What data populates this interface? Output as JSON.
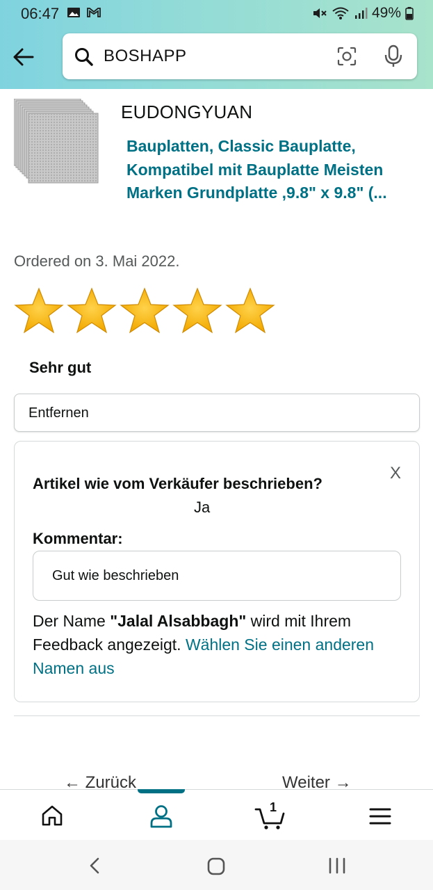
{
  "status_bar": {
    "time": "06:47",
    "battery": "49%"
  },
  "search": {
    "query": "BOSHAPP"
  },
  "product": {
    "brand": "EUDONGYUAN",
    "title": "Bauplatten, Classic Bauplatte, Kompatibel mit Bauplatte Meisten Marken Grundplatte ,9.8\" x 9.8\" (...",
    "ordered": "Ordered on 3. Mai 2022."
  },
  "rating": {
    "stars": 5,
    "max_stars": 5,
    "label": "Sehr gut"
  },
  "remove_button": "Entfernen",
  "feedback_card": {
    "close": "X",
    "question": "Artikel wie vom Verkäufer beschrieben?",
    "answer": "Ja",
    "comment_label": "Kommentar:",
    "comment_value": "Gut wie beschrieben",
    "name_prefix": "Der Name ",
    "name": "\"Jalal Alsabbagh\"",
    "name_suffix": " wird mit Ihrem Feedback angezeigt. ",
    "name_link": "Wählen Sie einen anderen Namen aus"
  },
  "pager": {
    "prev": "← Zurück",
    "next": "Weiter →"
  },
  "bottom_nav": {
    "cart_count": "1"
  },
  "colors": {
    "link": "#007185",
    "star": "#ffa41c"
  },
  "icons": [
    "image-icon",
    "gmail-icon",
    "mute-icon",
    "wifi-icon",
    "signal-icon",
    "battery-icon",
    "back-arrow-icon",
    "search-icon",
    "camera-icon",
    "mic-icon",
    "star-icon",
    "home-icon",
    "profile-icon",
    "cart-icon",
    "menu-icon",
    "nav-back-icon",
    "nav-home-icon",
    "nav-recents-icon"
  ]
}
